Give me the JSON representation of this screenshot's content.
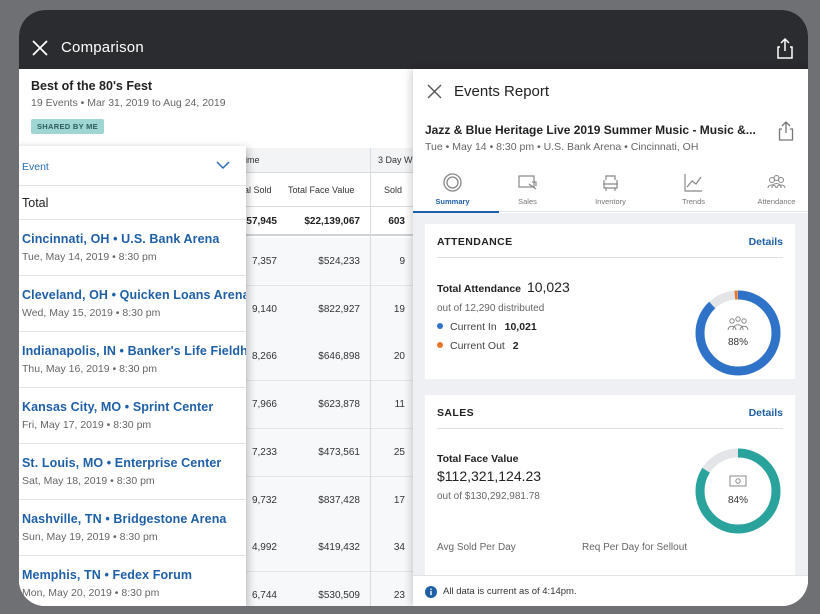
{
  "header": {
    "title": "Comparison"
  },
  "comparison": {
    "title": "Best of the 80's Fest",
    "subtitle": "19 Events • Mar 31, 2019 to Aug 24, 2019",
    "badge": "SHARED BY ME",
    "group_headers": [
      "ime",
      "3 Day W"
    ],
    "columns": [
      "al Sold",
      "Total Face Value",
      "Sold"
    ],
    "total_row": [
      "57,945",
      "$22,139,067",
      "603"
    ],
    "rows": [
      [
        "7,357",
        "$524,233",
        "9"
      ],
      [
        "9,140",
        "$822,927",
        "19"
      ],
      [
        "8,266",
        "$646,898",
        "20"
      ],
      [
        "7,966",
        "$623,878",
        "11"
      ],
      [
        "7,233",
        "$473,561",
        "25"
      ],
      [
        "9,732",
        "$837,428",
        "17"
      ],
      [
        "4,992",
        "$419,432",
        "34"
      ],
      [
        "6,744",
        "$530,509",
        "23"
      ]
    ]
  },
  "event_list": {
    "header_label": "Event",
    "total_label": "Total",
    "events": [
      {
        "name": "Cincinnati, OH • U.S. Bank Arena",
        "date": "Tue, May 14, 2019 • 8:30 pm"
      },
      {
        "name": "Cleveland, OH • Quicken Loans Arena",
        "date": "Wed, May 15, 2019 • 8:30 pm"
      },
      {
        "name": "Indianapolis, IN • Banker's Life Fieldhouse",
        "date": "Thu, May 16, 2019 • 8:30 pm"
      },
      {
        "name": "Kansas City, MO • Sprint Center",
        "date": "Fri, May 17, 2019 • 8:30 pm"
      },
      {
        "name": "St. Louis, MO • Enterprise Center",
        "date": "Sat, May 18, 2019 • 8:30 pm"
      },
      {
        "name": "Nashville, TN • Bridgestone Arena",
        "date": "Sun, May 19, 2019 • 8:30 pm"
      },
      {
        "name": "Memphis, TN • Fedex Forum",
        "date": "Mon, May 20, 2019 • 8:30 pm"
      }
    ]
  },
  "report": {
    "title": "Events Report",
    "event_name": "Jazz & Blue Heritage Live 2019 Summer Music - Music &...",
    "event_sub": "Tue • May 14 • 8:30 pm • U.S. Bank Arena • Cincinnati, OH",
    "tabs": [
      {
        "label": "Summary",
        "icon": "summary-icon",
        "active": true
      },
      {
        "label": "Sales",
        "icon": "sales-icon",
        "active": false
      },
      {
        "label": "Inventory",
        "icon": "inventory-icon",
        "active": false
      },
      {
        "label": "Trends",
        "icon": "trends-icon",
        "active": false
      },
      {
        "label": "Attendance",
        "icon": "attendance-icon",
        "active": false
      }
    ],
    "attendance": {
      "heading": "ATTENDANCE",
      "details": "Details",
      "total_label": "Total Attendance",
      "total_value": "10,023",
      "out_of": "out of 12,290 distributed",
      "current_in_label": "Current In",
      "current_in_value": "10,021",
      "current_out_label": "Current Out",
      "current_out_value": "2",
      "percent_label": "88%",
      "percent": 0.88,
      "in_color": "#2f73c9",
      "out_color": "#e8762d",
      "track_color": "#e3e5e8"
    },
    "sales": {
      "heading": "SALES",
      "details": "Details",
      "face_label": "Total Face Value",
      "face_value": "$112,321,124.23",
      "out_of": "out of $130,292,981.78",
      "percent_label": "84%",
      "percent": 0.84,
      "ring_color": "#2aa39d",
      "track_color": "#e3e5e8",
      "avg_label": "Avg Sold Per Day",
      "req_label": "Req Per Day for Sellout"
    },
    "footer": "All data is current as of 4:14pm."
  }
}
